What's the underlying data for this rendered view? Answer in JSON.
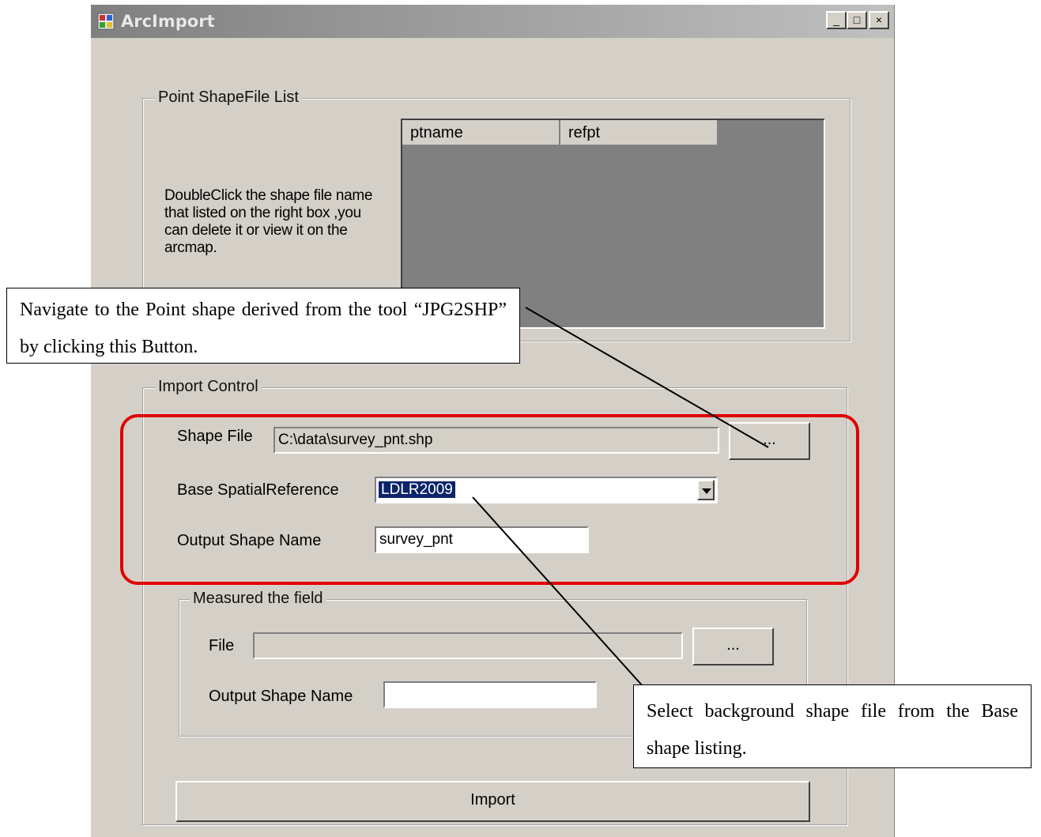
{
  "window": {
    "title": "ArcImport",
    "controls": {
      "minimize": "_",
      "maximize": "□",
      "close": "×"
    }
  },
  "point_list": {
    "group_label": "Point ShapeFile List",
    "hint": "DoubleClick the shape file name that listed on the right box ,you can delete it or view it on the arcmap.",
    "columns": [
      "ptname",
      "refpt"
    ]
  },
  "import_control": {
    "group_label": "Import Control",
    "shape_file_label": "Shape File",
    "shape_file_value": "C:\\data\\survey_pnt.shp",
    "browse_label": "...",
    "base_ref_label": "Base SpatialReference",
    "base_ref_value": "LDLR2009",
    "output_label": "Output Shape Name",
    "output_value": "survey_pnt"
  },
  "measured": {
    "group_label": "Measured the field",
    "file_label": "File",
    "file_value": "",
    "browse_label": "...",
    "output_label": "Output Shape Name",
    "output_value": ""
  },
  "import_button": "Import",
  "callouts": {
    "navigate": "Navigate to the Point shape derived from the tool “JPG2SHP” by clicking this Button.",
    "select": "Select background shape file from the Base shape listing."
  },
  "colors": {
    "window_bg": "#d4d0c8",
    "list_bg": "#808080",
    "highlight": "#0a246a",
    "annotation_red": "#e00000"
  }
}
